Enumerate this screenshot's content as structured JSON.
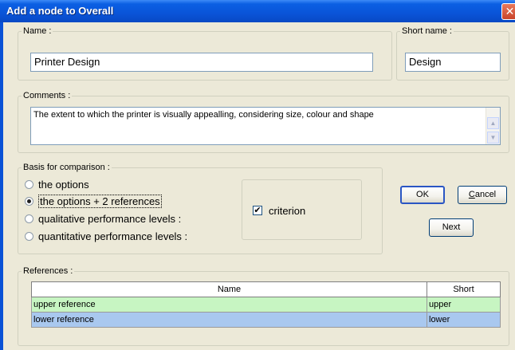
{
  "window": {
    "title": "Add a node to Overall",
    "close_glyph": "✕"
  },
  "name_group": {
    "legend": "Name :",
    "value": "Printer Design"
  },
  "short_name_group": {
    "legend": "Short name :",
    "value": "Design"
  },
  "comments_group": {
    "legend": "Comments :",
    "value": "The extent to which the printer is visually appealling, considering size, colour and shape",
    "scroll_up_glyph": "▲",
    "scroll_down_glyph": "▼"
  },
  "basis_group": {
    "legend": "Basis for comparison :",
    "options": [
      {
        "label": "the options",
        "selected": false
      },
      {
        "label": "the options + 2 references",
        "selected": true
      },
      {
        "label": "qualitative performance levels :",
        "selected": false
      },
      {
        "label": "quantitative performance levels :",
        "selected": false
      }
    ],
    "criterion_checkbox": {
      "label": "criterion",
      "checked": true,
      "glyph": "✔"
    }
  },
  "buttons": {
    "ok": "OK",
    "cancel_prefix": "",
    "cancel_underlined": "C",
    "cancel_rest": "ancel",
    "next": "Next"
  },
  "references_group": {
    "legend": "References :",
    "columns": [
      "Name",
      "Short"
    ],
    "rows": [
      {
        "name": "upper reference",
        "short": "upper",
        "color": "#c7f5c2"
      },
      {
        "name": "lower reference",
        "short": "lower",
        "color": "#a9c8ef"
      }
    ]
  },
  "colors": {
    "titlebar": "#0a54d8",
    "dialog_bg": "#ece9d8",
    "upper_row": "#c7f5c2",
    "lower_row": "#a9c8ef"
  }
}
